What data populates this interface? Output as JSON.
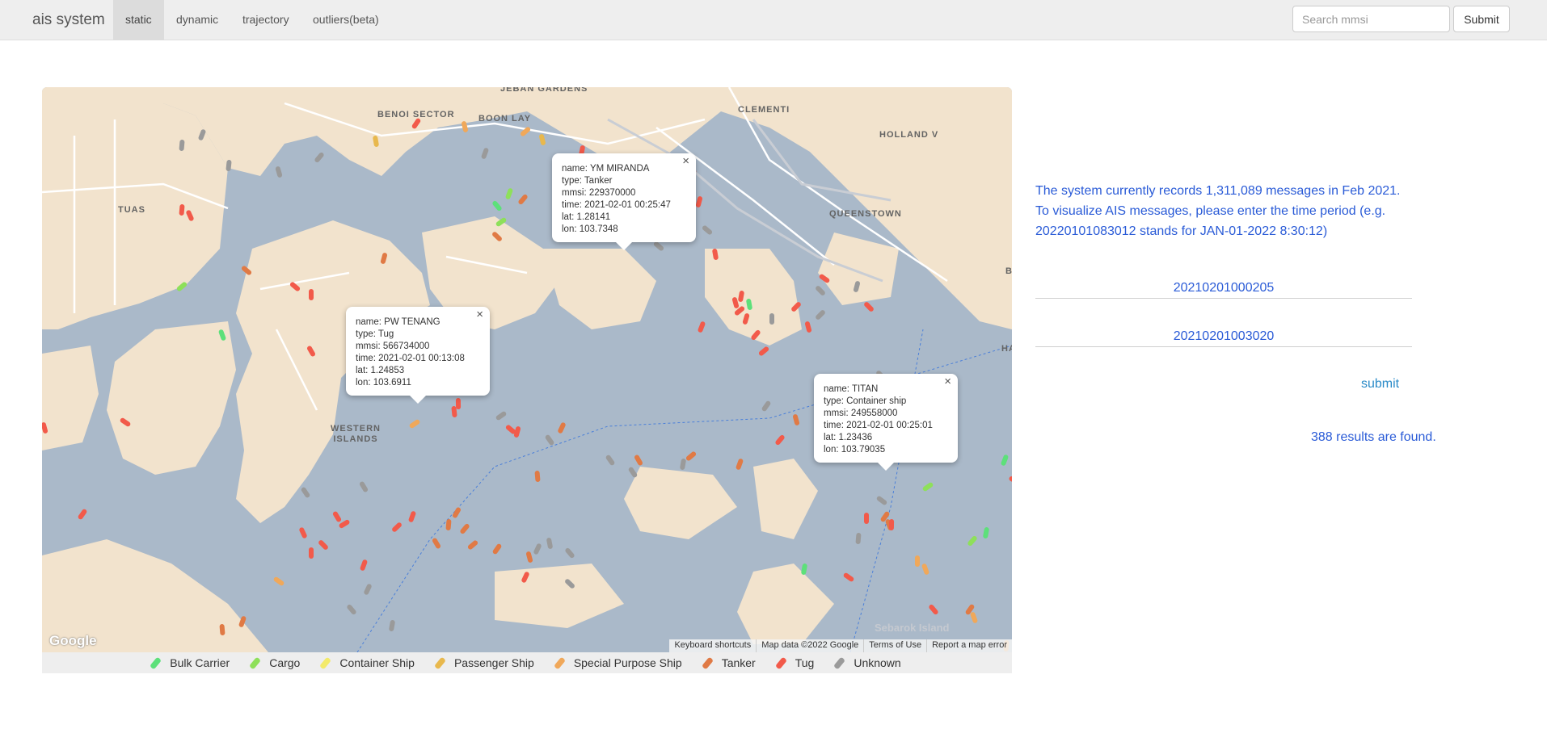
{
  "navbar": {
    "brand": "ais system",
    "tabs": [
      {
        "label": "static",
        "active": true
      },
      {
        "label": "dynamic",
        "active": false
      },
      {
        "label": "trajectory",
        "active": false
      },
      {
        "label": "outliers(beta)",
        "active": false
      }
    ],
    "search_placeholder": "Search mmsi",
    "submit_label": "Submit"
  },
  "map": {
    "places": [
      "JEBAN GARDENS",
      "BENOI SECTOR",
      "BOON LAY",
      "CLEMENTI",
      "HOLLAND V",
      "TUAS",
      "QUEENSTOWN",
      "WESTERN ISLANDS",
      "Sebarok Island",
      "HA",
      "B"
    ],
    "info_windows": [
      {
        "name": "name: YM MIRANDA",
        "type": "type: Tanker",
        "mmsi": "mmsi: 229370000",
        "time": "time: 2021-02-01 00:25:47",
        "lat": "lat: 1.28141",
        "lon": "lon: 103.7348"
      },
      {
        "name": "name: PW TENANG",
        "type": "type: Tug",
        "mmsi": "mmsi: 566734000",
        "time": "time: 2021-02-01 00:13:08",
        "lat": "lat: 1.24853",
        "lon": "lon: 103.6911"
      },
      {
        "name": "name: TITAN",
        "type": "type: Container ship",
        "mmsi": "mmsi: 249558000",
        "time": "time: 2021-02-01 00:25:01",
        "lat": "lat: 1.23436",
        "lon": "lon: 103.79035"
      }
    ],
    "close_symbol": "×",
    "google_logo": "Google",
    "attribution": [
      "Keyboard shortcuts",
      "Map data ©2022 Google",
      "Terms of Use",
      "Report a map error"
    ]
  },
  "legend": [
    {
      "label": "Bulk Carrier",
      "color": "#5de07a"
    },
    {
      "label": "Cargo",
      "color": "#8ee05a"
    },
    {
      "label": "Container Ship",
      "color": "#f3ea6a"
    },
    {
      "label": "Passenger Ship",
      "color": "#e8b84d"
    },
    {
      "label": "Special Purpose Ship",
      "color": "#f0a85a"
    },
    {
      "label": "Tanker",
      "color": "#e07a45"
    },
    {
      "label": "Tug",
      "color": "#f25a4a"
    },
    {
      "label": "Unknown",
      "color": "#9a9a9a"
    }
  ],
  "panel": {
    "line1": "The system currently records 1,311,089 messages in Feb 2021.",
    "line2": "To visualize AIS messages, please enter the time period (e.g.",
    "line3": "20220101083012 stands for JAN-01-2022 8:30:12)",
    "start_time": "20210201000205",
    "end_time": "20210201003020",
    "submit_label": "submit",
    "results": "388 results are found."
  }
}
